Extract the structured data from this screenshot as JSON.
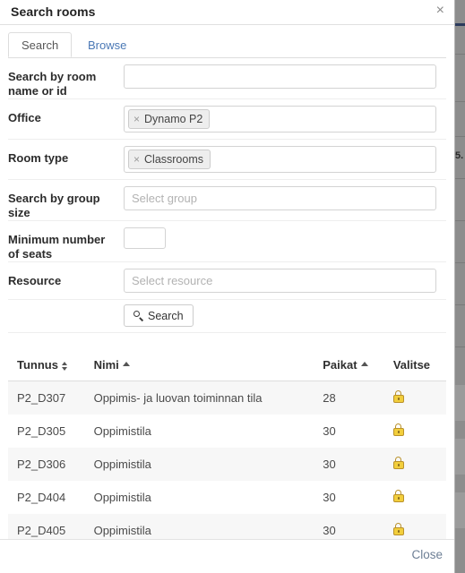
{
  "modal": {
    "title": "Search rooms",
    "close_icon": "close-x-icon",
    "close_label": "×",
    "footer_close_label": "Close"
  },
  "tabs": [
    {
      "label": "Search",
      "active": true
    },
    {
      "label": "Browse",
      "active": false
    }
  ],
  "form": {
    "rows": [
      {
        "label": "Search by room name or id",
        "type": "text",
        "value": "",
        "placeholder": ""
      },
      {
        "label": "Office",
        "type": "tokens",
        "tokens": [
          {
            "label": "Dynamo P2",
            "remove_label": "×"
          }
        ],
        "placeholder": ""
      },
      {
        "label": "Room type",
        "type": "tokens",
        "tokens": [
          {
            "label": "Classrooms",
            "remove_label": "×"
          }
        ],
        "placeholder": ""
      },
      {
        "label": "Search by group size",
        "type": "text",
        "value": "",
        "placeholder": "Select group"
      },
      {
        "label": "Minimum number of seats",
        "type": "number",
        "value": "",
        "placeholder": ""
      },
      {
        "label": "Resource",
        "type": "text",
        "value": "",
        "placeholder": "Select resource"
      }
    ],
    "search_button": {
      "label": "Search",
      "icon": "magnifier-icon"
    }
  },
  "results": {
    "columns": [
      {
        "key": "tunnus",
        "label": "Tunnus",
        "sort": "both"
      },
      {
        "key": "nimi",
        "label": "Nimi",
        "sort": "asc"
      },
      {
        "key": "paikat",
        "label": "Paikat",
        "sort": "asc"
      },
      {
        "key": "valitse",
        "label": "Valitse",
        "sort": "none"
      }
    ],
    "rows": [
      {
        "tunnus": "P2_D307",
        "nimi": "Oppimis- ja luovan toiminnan tila",
        "paikat": "28",
        "valitse_icon": "lock-icon"
      },
      {
        "tunnus": "P2_D305",
        "nimi": "Oppimistila",
        "paikat": "30",
        "valitse_icon": "lock-icon"
      },
      {
        "tunnus": "P2_D306",
        "nimi": "Oppimistila",
        "paikat": "30",
        "valitse_icon": "lock-icon"
      },
      {
        "tunnus": "P2_D404",
        "nimi": "Oppimistila",
        "paikat": "30",
        "valitse_icon": "lock-icon"
      },
      {
        "tunnus": "P2_D405",
        "nimi": "Oppimistila",
        "paikat": "30",
        "valitse_icon": "lock-icon"
      }
    ]
  },
  "backdrop": {
    "visible_text": "5."
  },
  "colors": {
    "link": "#4a78b5",
    "close_link": "#6d7f95",
    "lock": "#f2ce3c",
    "row_stripe": "#f7f7f7",
    "border": "#dddddd"
  }
}
